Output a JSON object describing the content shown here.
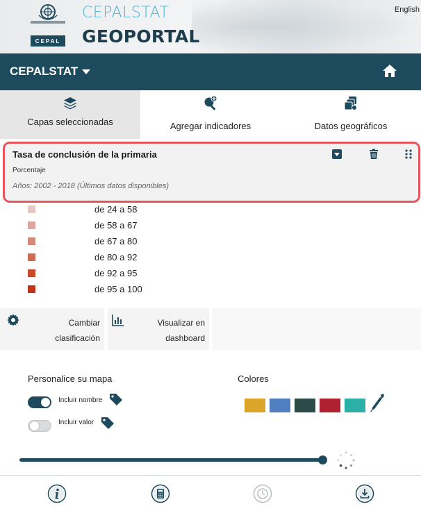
{
  "header": {
    "title_top": "CEPALSTAT",
    "title_bottom": "GEOPORTAL",
    "logo_text": "CEPAL",
    "language": "English"
  },
  "nav": {
    "brand": "CEPALSTAT"
  },
  "tabs": [
    {
      "label": "Capas seleccionadas",
      "icon": "layers-icon",
      "active": true
    },
    {
      "label": "Agregar indicadores",
      "icon": "search-plus-icon",
      "active": false
    },
    {
      "label": "Datos geográficos",
      "icon": "data-layers-icon",
      "active": false
    }
  ],
  "layer": {
    "title": "Tasa de conclusión de la primaria",
    "unit": "Porcentaje",
    "years": "Años: 2002 - 2018 (Últimos datos disponibles)"
  },
  "legend": [
    {
      "label": "de 24 a 58",
      "color": "#e6c7c4"
    },
    {
      "label": "de 58 a 67",
      "color": "#dca59f"
    },
    {
      "label": "de 67 a 80",
      "color": "#d4897a"
    },
    {
      "label": "de 80 a 92",
      "color": "#cf6a53"
    },
    {
      "label": "de 92 a 95",
      "color": "#c94b2c"
    },
    {
      "label": "de 95 a 100",
      "color": "#c0341a"
    }
  ],
  "actions": {
    "change_classification": "Cambiar\nclasificación",
    "change_line1": "Cambiar",
    "change_line2": "clasificación",
    "dashboard_line1": "Visualizar en",
    "dashboard_line2": "dashboard"
  },
  "personalize": {
    "title": "Personalice su mapa",
    "include_name": "Incluir nombre",
    "include_name_on": true,
    "include_value": "Incluir valor",
    "include_value_on": false,
    "colors_title": "Colores",
    "colors": [
      "#dba52a",
      "#4f7fbf",
      "#2c4a48",
      "#b0202e",
      "#2bb0a7"
    ]
  },
  "slider": {
    "value": 1.0
  },
  "bottom_icons": [
    "info-icon",
    "calculator-icon",
    "clock-icon",
    "download-icon"
  ],
  "palette": {
    "primary": "#1e4a5e",
    "accent": "#4ab3cf",
    "highlight": "#e8545c"
  }
}
